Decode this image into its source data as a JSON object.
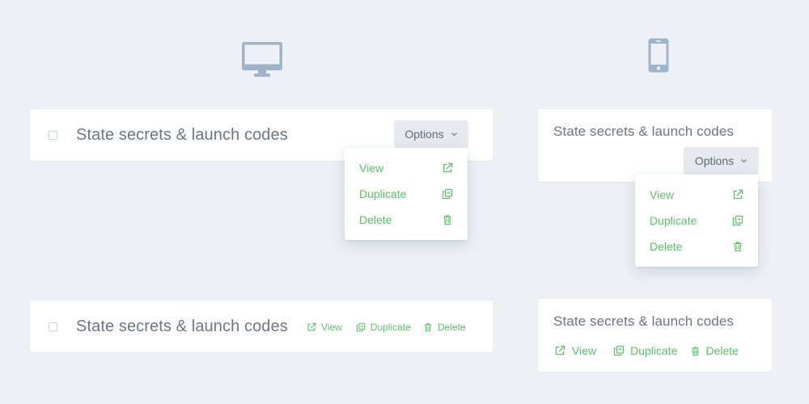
{
  "colors": {
    "background": "#edf1f6",
    "card": "#ffffff",
    "accent_green": "#5cbf6a",
    "title_gray": "#6b7683",
    "device_icon": "#9fb4c8",
    "button_bg": "#e6eaef"
  },
  "icons": {
    "desktop": "desktop-monitor-icon",
    "mobile": "smartphone-icon",
    "view": "external-link-icon",
    "duplicate": "copy-icon",
    "delete": "trash-icon",
    "chevron": "chevron-down-icon"
  },
  "desktop_dropdown": {
    "title": "State secrets & launch codes",
    "options_label": "Options",
    "menu": [
      {
        "label": "View"
      },
      {
        "label": "Duplicate"
      },
      {
        "label": "Delete"
      }
    ]
  },
  "mobile_dropdown": {
    "title": "State secrets & launch codes",
    "options_label": "Options",
    "menu": [
      {
        "label": "View"
      },
      {
        "label": "Duplicate"
      },
      {
        "label": "Delete"
      }
    ]
  },
  "desktop_inline": {
    "title": "State secrets & launch codes",
    "actions": [
      {
        "label": "View"
      },
      {
        "label": "Duplicate"
      },
      {
        "label": "Delete"
      }
    ]
  },
  "mobile_inline": {
    "title": "State secrets & launch codes",
    "actions": [
      {
        "label": "View"
      },
      {
        "label": "Duplicate"
      },
      {
        "label": "Delete"
      }
    ]
  }
}
